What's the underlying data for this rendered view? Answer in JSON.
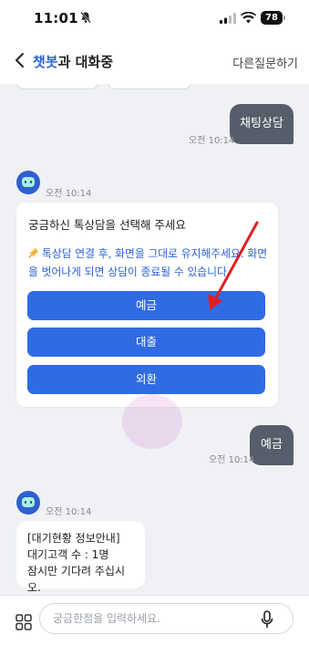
{
  "status_bar": {
    "time": "11:01",
    "battery": "78"
  },
  "header": {
    "title_accent": "챗봇",
    "title_rest": "과 대화중",
    "other_question": "다른질문하기"
  },
  "messages": {
    "user_1": {
      "text": "채팅상담",
      "time": "오전 10:14"
    },
    "bot_1": {
      "time": "오전 10:14",
      "title": "궁금하신 톡상담을 선택해 주세요",
      "notice": "톡상담 연결 후, 화면을 그대로 유지해주세요. 화면을 벗어나게 되면 상담이 종료될 수 있습니다.",
      "options": [
        "예금",
        "대출",
        "외환"
      ]
    },
    "user_2": {
      "text": "예금",
      "time": "오전 10:14"
    },
    "bot_2": {
      "time": "오전 10:14",
      "lines": [
        "[대기현황 정보안내]",
        "대기고객 수 : 1명",
        "잠시만 기다려 주십시오."
      ]
    }
  },
  "input": {
    "placeholder": "궁금한점을 입력하세요."
  },
  "colors": {
    "accent": "#2c62d8",
    "button": "#2f6be3",
    "user_bubble": "#555e6a",
    "chat_bg": "#eff1f5",
    "annotation_arrow": "#e02020"
  },
  "icons": [
    "back-icon",
    "bell-off-icon",
    "signal-icon",
    "wifi-icon",
    "bot-avatar-icon",
    "pin-icon",
    "menu-grid-icon",
    "mic-icon"
  ]
}
